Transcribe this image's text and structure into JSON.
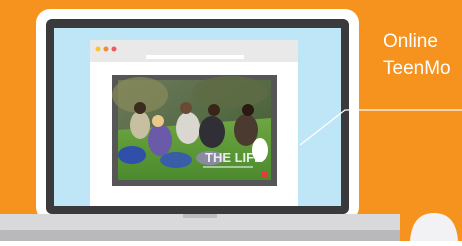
{
  "colors": {
    "background": "#f6921e",
    "laptop_frame": "#ffffff",
    "screen_bezel": "#3a3a3c",
    "screen_area": "#bfe6f6",
    "browser_chrome": "#e9e9ea",
    "browser_dot_red": "#f15a5a",
    "browser_dot_yellow": "#f7c52e",
    "browser_dot_orange": "#f08a3e",
    "photo_border": "#565656",
    "laptop_base": "#d9d9db",
    "mouse": "#f2f2f4"
  },
  "callout": {
    "line1": "Online",
    "line2": "TeenMo"
  },
  "cover": {
    "title_text": "THE LIFE",
    "icon": "photo-icon"
  },
  "icons": {
    "browser_dots": "window-control-dots-icon",
    "mouse": "mouse-icon"
  }
}
